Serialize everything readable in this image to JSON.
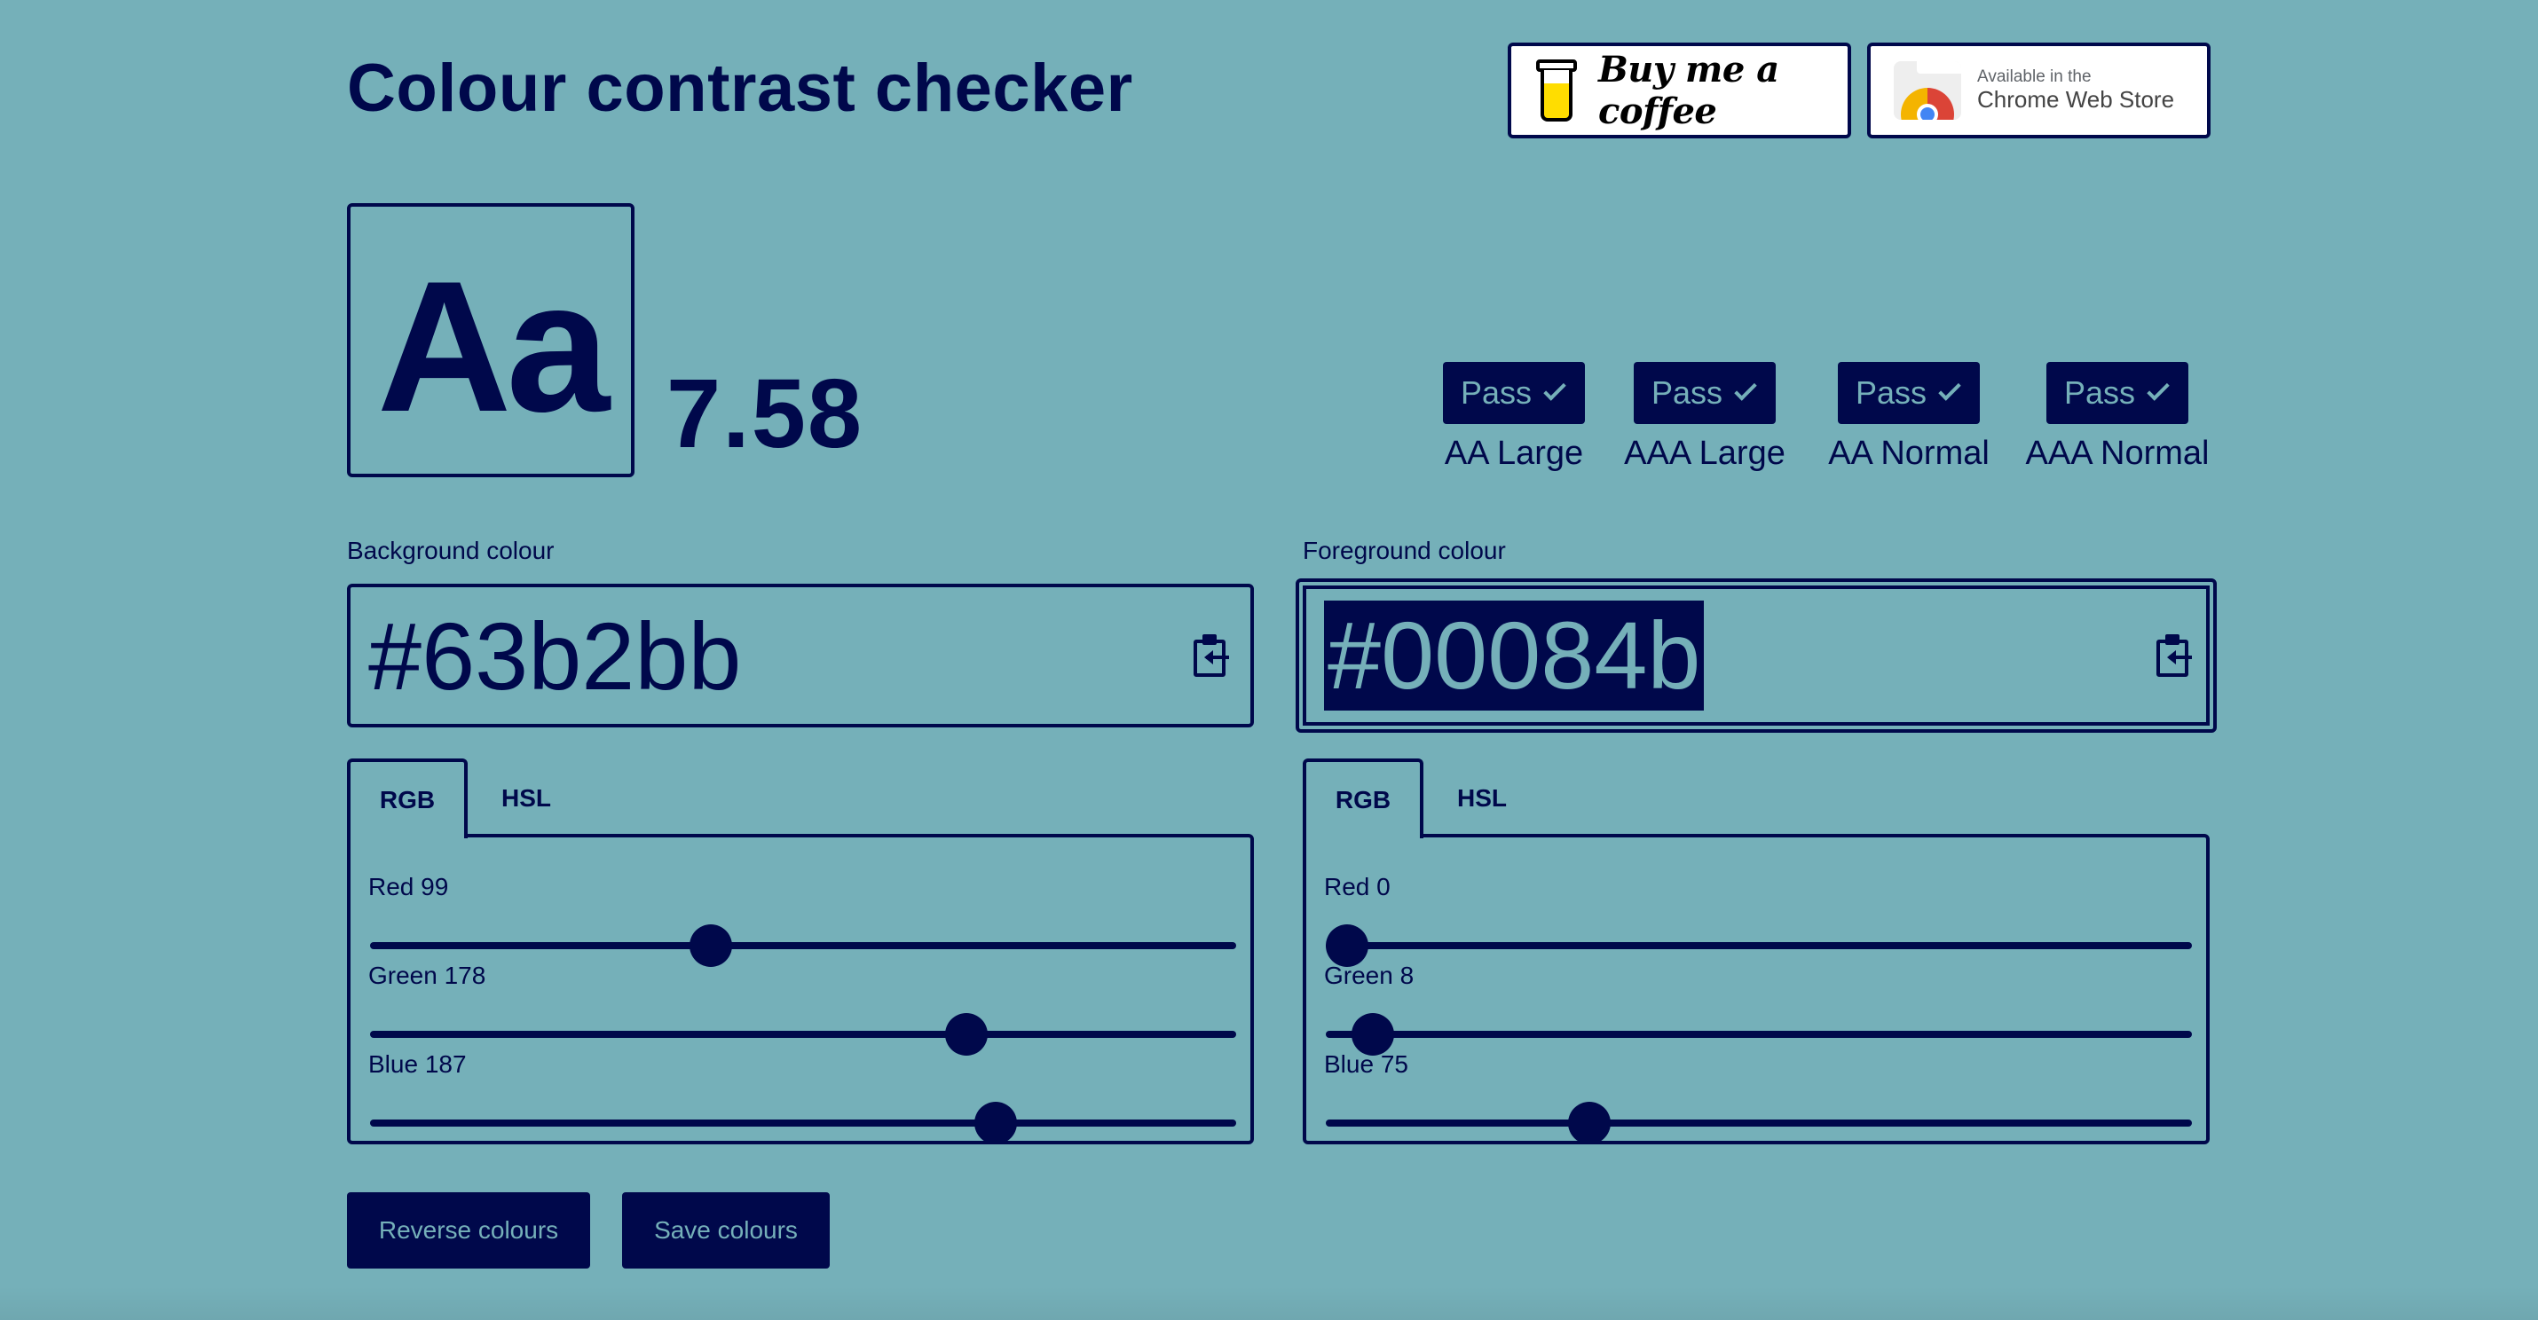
{
  "theme": {
    "background": "#75b0b9",
    "foreground": "#00084b"
  },
  "header": {
    "title": "Colour contrast checker"
  },
  "promos": {
    "coffee_label": "Buy me a coffee",
    "store_small": "Available in the",
    "store_big": "Chrome Web Store"
  },
  "preview": {
    "sample_text": "Aa",
    "ratio": "7.58"
  },
  "results": [
    {
      "status": "Pass",
      "label": "AA Large"
    },
    {
      "status": "Pass",
      "label": "AAA Large"
    },
    {
      "status": "Pass",
      "label": "AA Normal"
    },
    {
      "status": "Pass",
      "label": "AAA Normal"
    }
  ],
  "background_panel": {
    "label": "Background colour",
    "hex": "#63b2bb",
    "tabs": [
      "RGB",
      "HSL"
    ],
    "active_tab": "RGB",
    "sliders": [
      {
        "label": "Red 99",
        "name": "Red",
        "value": 99,
        "max": 255
      },
      {
        "label": "Green 178",
        "name": "Green",
        "value": 178,
        "max": 255
      },
      {
        "label": "Blue 187",
        "name": "Blue",
        "value": 187,
        "max": 255
      }
    ]
  },
  "foreground_panel": {
    "label": "Foreground colour",
    "hex": "#00084b",
    "tabs": [
      "RGB",
      "HSL"
    ],
    "active_tab": "RGB",
    "sliders": [
      {
        "label": "Red 0",
        "name": "Red",
        "value": 0,
        "max": 255
      },
      {
        "label": "Green 8",
        "name": "Green",
        "value": 8,
        "max": 255
      },
      {
        "label": "Blue 75",
        "name": "Blue",
        "value": 75,
        "max": 255
      }
    ]
  },
  "actions": {
    "reverse": "Reverse colours",
    "save": "Save colours"
  }
}
